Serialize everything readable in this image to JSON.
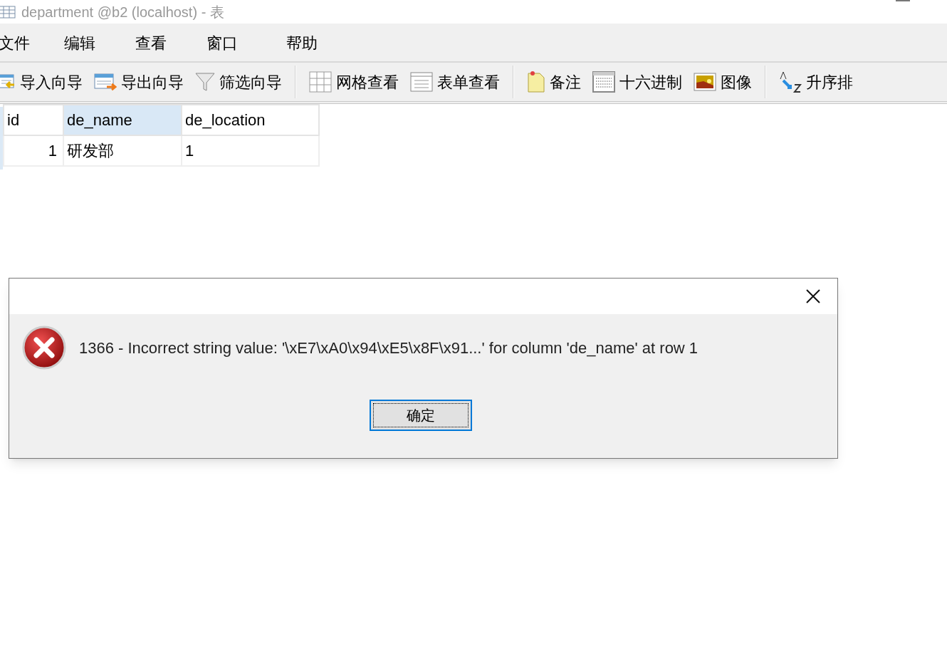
{
  "window": {
    "title": "department @b2 (localhost) - 表"
  },
  "menu": [
    "文件",
    "编辑",
    "查看",
    "窗口",
    "帮助"
  ],
  "toolbar": [
    {
      "kind": "import",
      "label": "导入向导"
    },
    {
      "kind": "export",
      "label": "导出向导"
    },
    {
      "kind": "filter",
      "label": "筛选向导"
    },
    {
      "kind": "separator"
    },
    {
      "kind": "grid",
      "label": "网格查看"
    },
    {
      "kind": "form",
      "label": "表单查看"
    },
    {
      "kind": "separator"
    },
    {
      "kind": "memo",
      "label": "备注"
    },
    {
      "kind": "hex",
      "label": "十六进制"
    },
    {
      "kind": "image",
      "label": "图像"
    },
    {
      "kind": "separator"
    },
    {
      "kind": "sort",
      "label": "升序排"
    }
  ],
  "table": {
    "columns": [
      {
        "label": "id",
        "selected": false
      },
      {
        "label": "de_name",
        "selected": true
      },
      {
        "label": "de_location",
        "selected": false
      }
    ],
    "rows": [
      [
        "1",
        "研发部",
        "1"
      ]
    ]
  },
  "dialog": {
    "message": "1366 - Incorrect string value: '\\xE7\\xA0\\x94\\xE5\\x8F\\x91...' for column 'de_name' at row 1",
    "button": "确定"
  }
}
